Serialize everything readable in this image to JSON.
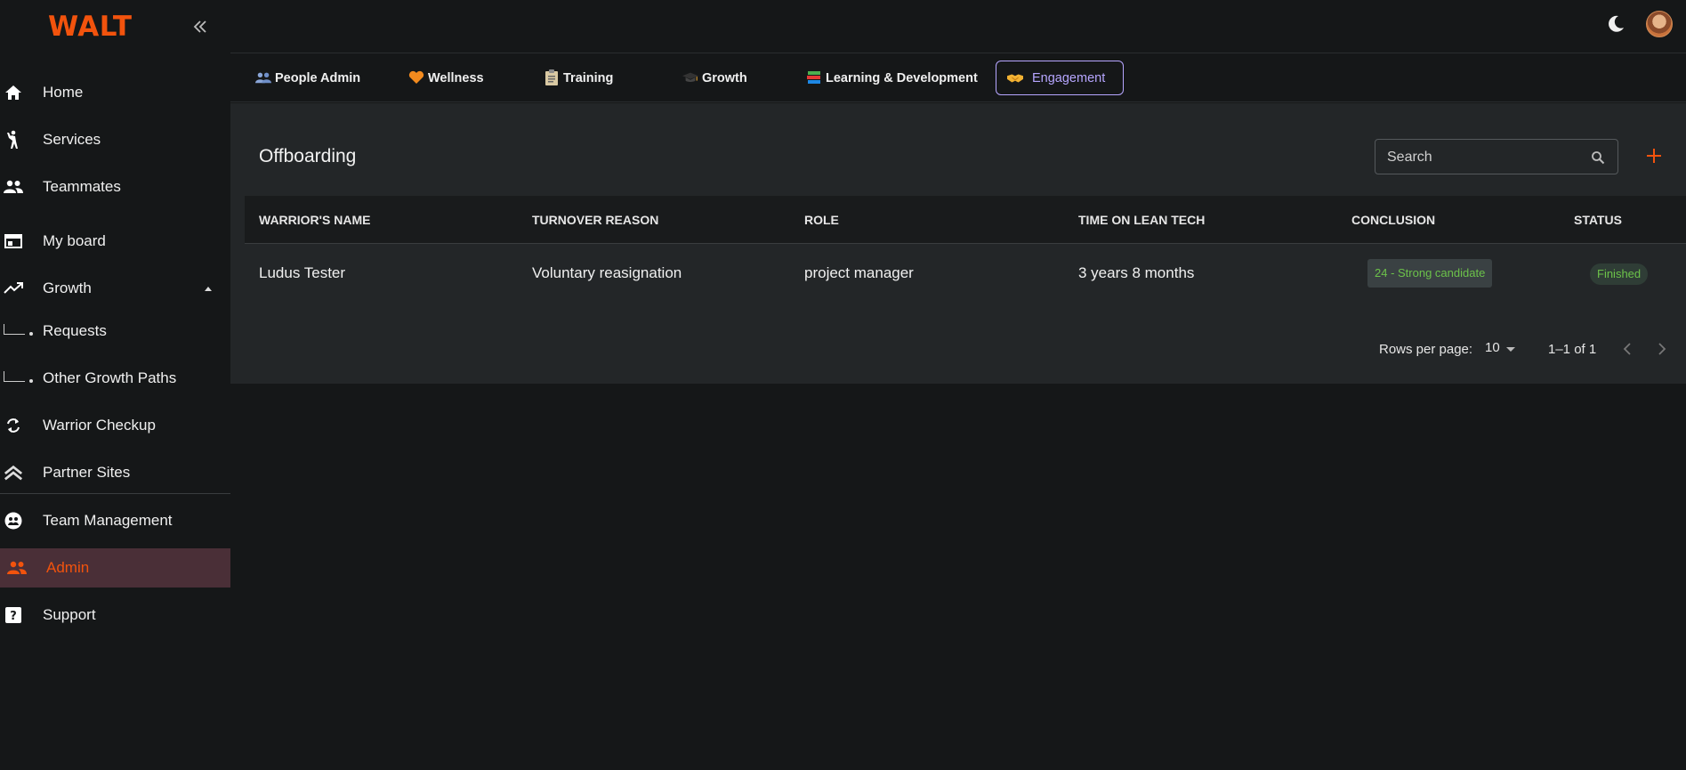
{
  "app": {
    "logo": "WALT"
  },
  "sidebar": {
    "items": [
      {
        "label": "Home"
      },
      {
        "label": "Services"
      },
      {
        "label": "Teammates"
      },
      {
        "label": "My board"
      },
      {
        "label": "Growth"
      },
      {
        "label": "Requests"
      },
      {
        "label": "Other Growth Paths"
      },
      {
        "label": "Warrior Checkup"
      },
      {
        "label": "Partner Sites"
      },
      {
        "label": "Team Management"
      },
      {
        "label": "Admin",
        "active": true
      },
      {
        "label": "Support"
      }
    ]
  },
  "tabs": [
    {
      "label": "People Admin",
      "icon": "people-icon"
    },
    {
      "label": "Wellness",
      "icon": "heart-icon"
    },
    {
      "label": "Training",
      "icon": "clipboard-icon"
    },
    {
      "label": "Growth",
      "icon": "graduation-cap-icon"
    },
    {
      "label": "Learning & Development",
      "icon": "books-icon"
    },
    {
      "label": "Engagement",
      "icon": "handshake-icon",
      "selected": true
    }
  ],
  "main": {
    "title": "Offboarding",
    "search": {
      "placeholder": "Search"
    },
    "table": {
      "headers": [
        "WARRIOR'S NAME",
        "TURNOVER REASON",
        "ROLE",
        "TIME ON LEAN TECH",
        "CONCLUSION",
        "STATUS"
      ],
      "rows": [
        {
          "name": "Ludus Tester",
          "reason": "Voluntary reasignation",
          "role": "project manager",
          "time": "3 years 8 months",
          "conclusion": "24 - Strong candidate",
          "status": "Finished"
        }
      ]
    },
    "pagination": {
      "rows_per_page_label": "Rows per page:",
      "rows_per_page": "10",
      "range": "1–1 of 1"
    }
  },
  "colors": {
    "accent": "#f2530d",
    "selected_tab": "#b6a6ff",
    "success": "#6cc24a",
    "background": "#151718",
    "panel": "#232628"
  }
}
